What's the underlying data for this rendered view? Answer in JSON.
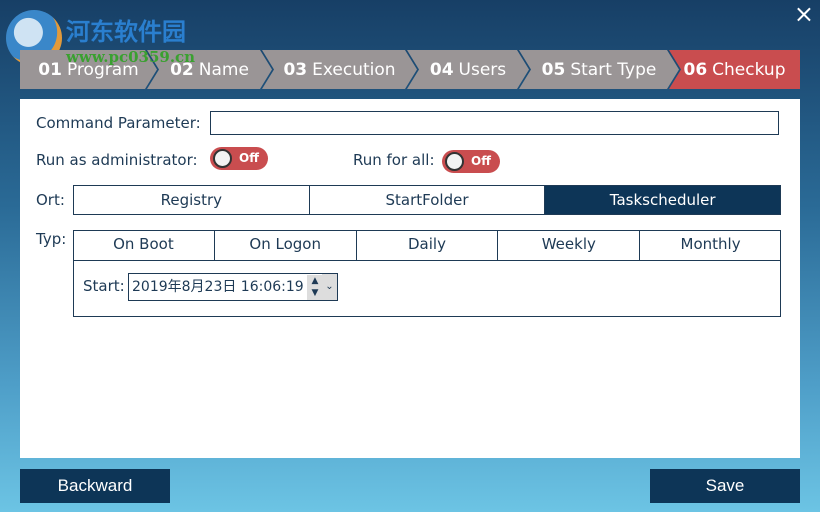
{
  "brand": {
    "name": "河东软件园",
    "url": "www.pc0359.cn"
  },
  "close_icon": "×",
  "steps": [
    {
      "num": "01",
      "label": "Program"
    },
    {
      "num": "02",
      "label": "Name"
    },
    {
      "num": "03",
      "label": "Execution"
    },
    {
      "num": "04",
      "label": "Users"
    },
    {
      "num": "05",
      "label": "Start Type"
    },
    {
      "num": "06",
      "label": "Checkup"
    }
  ],
  "form": {
    "command_label": "Command Parameter:",
    "command_value": "",
    "admin_label": "Run as administrator:",
    "admin_toggle": "Off",
    "all_label": "Run for all:",
    "all_toggle": "Off",
    "ort_label": "Ort:",
    "ort_options": [
      "Registry",
      "StartFolder",
      "Taskscheduler"
    ],
    "typ_label": "Typ:",
    "typ_options": [
      "On Boot",
      "On Logon",
      "Daily",
      "Weekly",
      "Monthly"
    ],
    "start_label": "Start:",
    "start_value": "2019年8月23日 16:06:19"
  },
  "buttons": {
    "backward": "Backward",
    "save": "Save"
  },
  "colors": {
    "accent": "#0d3557",
    "active_step": "#c94d4f",
    "step": "#9a9596"
  }
}
